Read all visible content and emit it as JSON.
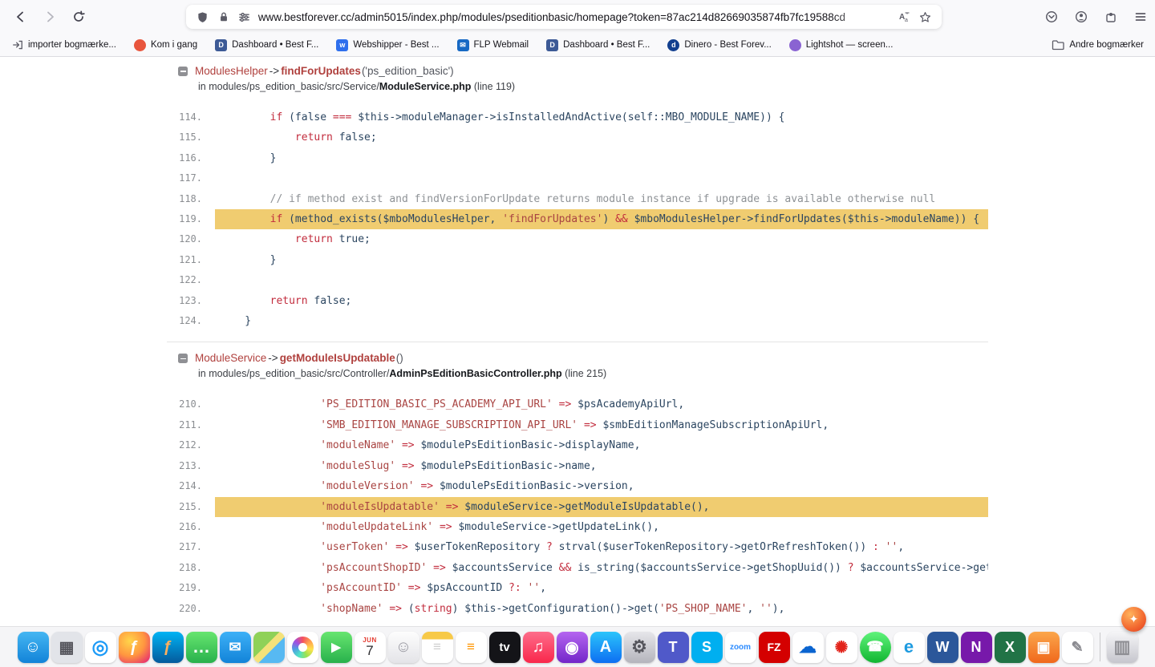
{
  "browser": {
    "url": "www.bestforever.cc/admin5015/index.php/modules/pseditionbasic/homepage?token=87ac214d82669035874fb7fc19588cd",
    "bookmarks_bar": {
      "items": [
        {
          "label": "importer bogmærke...",
          "kind": "import",
          "color": "#5b5b66",
          "letter": ""
        },
        {
          "label": "Kom i gang",
          "kind": "dot",
          "color": "#e8553d",
          "letter": ""
        },
        {
          "label": "Dashboard • Best F...",
          "kind": "square",
          "color": "#3d5a96",
          "letter": "D"
        },
        {
          "label": "Webshipper - Best ...",
          "kind": "square",
          "color": "#2f6fed",
          "letter": "w"
        },
        {
          "label": "FLP Webmail",
          "kind": "square",
          "color": "#1769c4",
          "letter": "✉"
        },
        {
          "label": "Dashboard • Best F...",
          "kind": "square",
          "color": "#3d5a96",
          "letter": "D"
        },
        {
          "label": "Dinero - Best Forev...",
          "kind": "dot",
          "color": "#123f8f",
          "letter": "d"
        },
        {
          "label": "Lightshot — screen...",
          "kind": "dot",
          "color": "#8a63d2",
          "letter": ""
        }
      ],
      "other_bookmarks_label": "Andre bogmærker"
    }
  },
  "page": {
    "trace_blocks": [
      {
        "class_name": "ModulesHelper",
        "separator": "->",
        "method": "findForUpdates",
        "args": " ('ps_edition_basic')",
        "location_prefix": "in modules/ps_edition_basic/src/Service/",
        "file": "ModuleService.php",
        "location_suffix": " (line 119)",
        "highlight": "119.",
        "lines": [
          {
            "no": "114.",
            "tokens": [
              [
                "p",
                "        "
              ],
              [
                "k",
                "if"
              ],
              [
                "p",
                " (false "
              ],
              [
                "k",
                "==="
              ],
              [
                "p",
                " $this->moduleManager->isInstalledAndActive(self::MBO_MODULE_NAME)) {"
              ]
            ]
          },
          {
            "no": "115.",
            "tokens": [
              [
                "p",
                "            "
              ],
              [
                "k",
                "return"
              ],
              [
                "p",
                " false;"
              ]
            ]
          },
          {
            "no": "116.",
            "tokens": [
              [
                "p",
                "        }"
              ]
            ]
          },
          {
            "no": "117.",
            "tokens": []
          },
          {
            "no": "118.",
            "tokens": [
              [
                "c",
                "        // if method exist and findVersionForUpdate returns module instance if upgrade is available otherwise null"
              ]
            ]
          },
          {
            "no": "119.",
            "tokens": [
              [
                "p",
                "        "
              ],
              [
                "k",
                "if"
              ],
              [
                "p",
                " (method_exists($mboModulesHelper, "
              ],
              [
                "s",
                "'findForUpdates'"
              ],
              [
                "p",
                ") "
              ],
              [
                "k",
                "&&"
              ],
              [
                "p",
                " $mboModulesHelper->findForUpdates($this->moduleName)) {"
              ]
            ]
          },
          {
            "no": "120.",
            "tokens": [
              [
                "p",
                "            "
              ],
              [
                "k",
                "return"
              ],
              [
                "p",
                " true;"
              ]
            ]
          },
          {
            "no": "121.",
            "tokens": [
              [
                "p",
                "        }"
              ]
            ]
          },
          {
            "no": "122.",
            "tokens": []
          },
          {
            "no": "123.",
            "tokens": [
              [
                "p",
                "        "
              ],
              [
                "k",
                "return"
              ],
              [
                "p",
                " false;"
              ]
            ]
          },
          {
            "no": "124.",
            "tokens": [
              [
                "p",
                "    }"
              ]
            ]
          }
        ]
      },
      {
        "class_name": "ModuleService",
        "separator": "->",
        "method": "getModuleIsUpdatable",
        "args": " ()",
        "location_prefix": "in modules/ps_edition_basic/src/Controller/",
        "file": "AdminPsEditionBasicController.php",
        "location_suffix": " (line 215)",
        "highlight": "215.",
        "lines": [
          {
            "no": "210.",
            "tokens": [
              [
                "p",
                "                "
              ],
              [
                "s",
                "'PS_EDITION_BASIC_PS_ACADEMY_API_URL'"
              ],
              [
                "k",
                " => "
              ],
              [
                "p",
                "$psAcademyApiUrl,"
              ]
            ]
          },
          {
            "no": "211.",
            "tokens": [
              [
                "p",
                "                "
              ],
              [
                "s",
                "'SMB_EDITION_MANAGE_SUBSCRIPTION_API_URL'"
              ],
              [
                "k",
                " => "
              ],
              [
                "p",
                "$smbEditionManageSubscriptionApiUrl,"
              ]
            ]
          },
          {
            "no": "212.",
            "tokens": [
              [
                "p",
                "                "
              ],
              [
                "s",
                "'moduleName'"
              ],
              [
                "k",
                " => "
              ],
              [
                "p",
                "$modulePsEditionBasic->displayName,"
              ]
            ]
          },
          {
            "no": "213.",
            "tokens": [
              [
                "p",
                "                "
              ],
              [
                "s",
                "'moduleSlug'"
              ],
              [
                "k",
                " => "
              ],
              [
                "p",
                "$modulePsEditionBasic->name,"
              ]
            ]
          },
          {
            "no": "214.",
            "tokens": [
              [
                "p",
                "                "
              ],
              [
                "s",
                "'moduleVersion'"
              ],
              [
                "k",
                " => "
              ],
              [
                "p",
                "$modulePsEditionBasic->version,"
              ]
            ]
          },
          {
            "no": "215.",
            "tokens": [
              [
                "p",
                "                "
              ],
              [
                "s",
                "'moduleIsUpdatable'"
              ],
              [
                "k",
                " => "
              ],
              [
                "p",
                "$moduleService->getModuleIsUpdatable(),"
              ]
            ]
          },
          {
            "no": "216.",
            "tokens": [
              [
                "p",
                "                "
              ],
              [
                "s",
                "'moduleUpdateLink'"
              ],
              [
                "k",
                " => "
              ],
              [
                "p",
                "$moduleService->getUpdateLink(),"
              ]
            ]
          },
          {
            "no": "217.",
            "tokens": [
              [
                "p",
                "                "
              ],
              [
                "s",
                "'userToken'"
              ],
              [
                "k",
                " => "
              ],
              [
                "p",
                "$userTokenRepository "
              ],
              [
                "k",
                "?"
              ],
              [
                "p",
                " strval($userTokenRepository->getOrRefreshToken()) "
              ],
              [
                "k",
                ":"
              ],
              [
                "p",
                " "
              ],
              [
                "s",
                "''"
              ],
              [
                "p",
                ","
              ]
            ]
          },
          {
            "no": "218.",
            "tokens": [
              [
                "p",
                "                "
              ],
              [
                "s",
                "'psAccountShopID'"
              ],
              [
                "k",
                " => "
              ],
              [
                "p",
                "$accountsService "
              ],
              [
                "k",
                "&&"
              ],
              [
                "p",
                " is_string($accountsService->getShopUuid()) "
              ],
              [
                "k",
                "?"
              ],
              [
                "p",
                " $accountsService->getShopUuid() "
              ],
              [
                "k",
                ":"
              ],
              [
                "p",
                " "
              ],
              [
                "s",
                "''"
              ],
              [
                "p",
                ","
              ]
            ]
          },
          {
            "no": "219.",
            "tokens": [
              [
                "p",
                "                "
              ],
              [
                "s",
                "'psAccountID'"
              ],
              [
                "k",
                " => "
              ],
              [
                "p",
                "$psAccountID "
              ],
              [
                "k",
                "?:"
              ],
              [
                "p",
                " "
              ],
              [
                "s",
                "''"
              ],
              [
                "p",
                ","
              ]
            ]
          },
          {
            "no": "220.",
            "tokens": [
              [
                "p",
                "                "
              ],
              [
                "s",
                "'shopName'"
              ],
              [
                "k",
                " => "
              ],
              [
                "p",
                "("
              ],
              [
                "k",
                "string"
              ],
              [
                "p",
                ") $this->getConfiguration()->get("
              ],
              [
                "s",
                "'PS_SHOP_NAME'"
              ],
              [
                "p",
                ", "
              ],
              [
                "s",
                "''"
              ],
              [
                "p",
                "),"
              ]
            ]
          }
        ]
      },
      {
        "stub": true
      }
    ]
  },
  "dock": {
    "items": [
      {
        "name": "finder",
        "label": "☺",
        "bg": "linear-gradient(180deg,#45b6f2,#1283d8)",
        "fg": "#ffffff",
        "fs": 20
      },
      {
        "name": "launchpad",
        "label": "▦",
        "bg": "#e2e4e9",
        "fg": "#55555c",
        "fs": 20
      },
      {
        "name": "safari",
        "label": "◎",
        "bg": "#ffffff",
        "fg": "#1b9af7",
        "fs": 24
      },
      {
        "name": "firefox",
        "label": "ƒ",
        "bg": "radial-gradient(circle at 35% 30%,#ffd54a,#ff9640 50%,#e8336e 90%)",
        "fg": "#ffffff",
        "fs": 20
      },
      {
        "name": "firefox-developer",
        "label": "ƒ",
        "bg": "linear-gradient(180deg,#00b3f4,#045a9c)",
        "fg": "#ffb05e",
        "fs": 20
      },
      {
        "name": "messages",
        "label": "…",
        "bg": "linear-gradient(180deg,#67e56f,#28b14c)",
        "fg": "#ffffff",
        "fs": 22
      },
      {
        "name": "mail",
        "label": "✉",
        "bg": "linear-gradient(180deg,#3db0f7,#1283d8)",
        "fg": "#ffffff",
        "fs": 18
      },
      {
        "name": "maps",
        "label": "",
        "bg": "linear-gradient(135deg,#8fd158 0%,#8fd158 42%,#f4e27a 42%,#f4e27a 58%,#57b9f2 58%)",
        "fg": "#ffffff",
        "fs": 16
      },
      {
        "name": "photos",
        "type": "photos",
        "bg": "#ffffff"
      },
      {
        "name": "facetime",
        "label": "▶",
        "bg": "linear-gradient(180deg,#67e56f,#28b14c)",
        "fg": "#ffffff",
        "fs": 15
      },
      {
        "name": "calendar",
        "type": "calendar",
        "bg": "#ffffff",
        "month": "JUN",
        "day": "7"
      },
      {
        "name": "contacts",
        "label": "☺",
        "bg": "linear-gradient(180deg,#fdfdfd,#e4e4e8)",
        "fg": "#9a9aa2",
        "fs": 20
      },
      {
        "name": "notes",
        "label": "≡",
        "bg": "linear-gradient(180deg,#f7c948 0%,#f7c948 24%,#ffffff 24%)",
        "fg": "#cfcfcf",
        "fs": 17
      },
      {
        "name": "reminders",
        "label": "≡",
        "bg": "#ffffff",
        "fg": "#ff9500",
        "fs": 17
      },
      {
        "name": "tv",
        "label": "tv",
        "bg": "#141418",
        "fg": "#ffffff",
        "fs": 15
      },
      {
        "name": "music",
        "label": "♫",
        "bg": "linear-gradient(180deg,#fd6d8b,#f9274b)",
        "fg": "#ffffff",
        "fs": 20
      },
      {
        "name": "podcasts",
        "label": "◉",
        "bg": "linear-gradient(180deg,#b465f0,#7326c9)",
        "fg": "#ffffff",
        "fs": 20
      },
      {
        "name": "app-store",
        "label": "A",
        "bg": "linear-gradient(180deg,#2bc4fb,#0d6ef2)",
        "fg": "#ffffff",
        "fs": 20
      },
      {
        "name": "system-settings",
        "label": "⚙",
        "bg": "linear-gradient(180deg,#e6e6ea,#b4b4bc)",
        "fg": "#55555c",
        "fs": 22
      },
      {
        "name": "teams",
        "label": "T",
        "bg": "#5059c9",
        "fg": "#ffffff",
        "fs": 18
      },
      {
        "name": "skype",
        "label": "S",
        "bg": "#00aff0",
        "fg": "#ffffff",
        "fs": 18
      },
      {
        "name": "zoom",
        "label": "zoom",
        "bg": "#ffffff",
        "fg": "#2d8cff",
        "fs": 10
      },
      {
        "name": "filezilla",
        "label": "FZ",
        "bg": "#d40000",
        "fg": "#ffffff",
        "fs": 14
      },
      {
        "name": "onedrive",
        "label": "☁",
        "bg": "#ffffff",
        "fg": "#0a64d0",
        "fs": 22
      },
      {
        "name": "acrobat",
        "label": "✺",
        "bg": "#ffffff",
        "fg": "#e2231a",
        "fs": 20
      },
      {
        "name": "whatsapp",
        "label": "☎",
        "bg": "linear-gradient(180deg,#5ff37b,#11b531)",
        "fg": "#ffffff",
        "fs": 17,
        "round": true
      },
      {
        "name": "edge",
        "label": "e",
        "bg": "#ffffff",
        "fg": "#1e9be0",
        "fs": 22
      },
      {
        "name": "word",
        "label": "W",
        "bg": "#2b579a",
        "fg": "#ffffff",
        "fs": 18
      },
      {
        "name": "onenote",
        "label": "N",
        "bg": "#7719aa",
        "fg": "#ffffff",
        "fs": 18
      },
      {
        "name": "excel",
        "label": "X",
        "bg": "#217346",
        "fg": "#ffffff",
        "fs": 18
      },
      {
        "name": "remote-desktop",
        "label": "▣",
        "bg": "linear-gradient(180deg,#fba64b,#f0681c)",
        "fg": "#ffffff",
        "fs": 18
      },
      {
        "name": "textedit",
        "label": "✎",
        "bg": "#ffffff",
        "fg": "#8a8a90",
        "fs": 18
      },
      {
        "name": "dock-separator",
        "type": "separator"
      },
      {
        "name": "trash",
        "label": "▥",
        "bg": "linear-gradient(180deg,#f5f5f7,#c6c6cd)",
        "fg": "#8e8e93",
        "fs": 22
      }
    ]
  },
  "overlay": {
    "float_glyph": "✦"
  }
}
